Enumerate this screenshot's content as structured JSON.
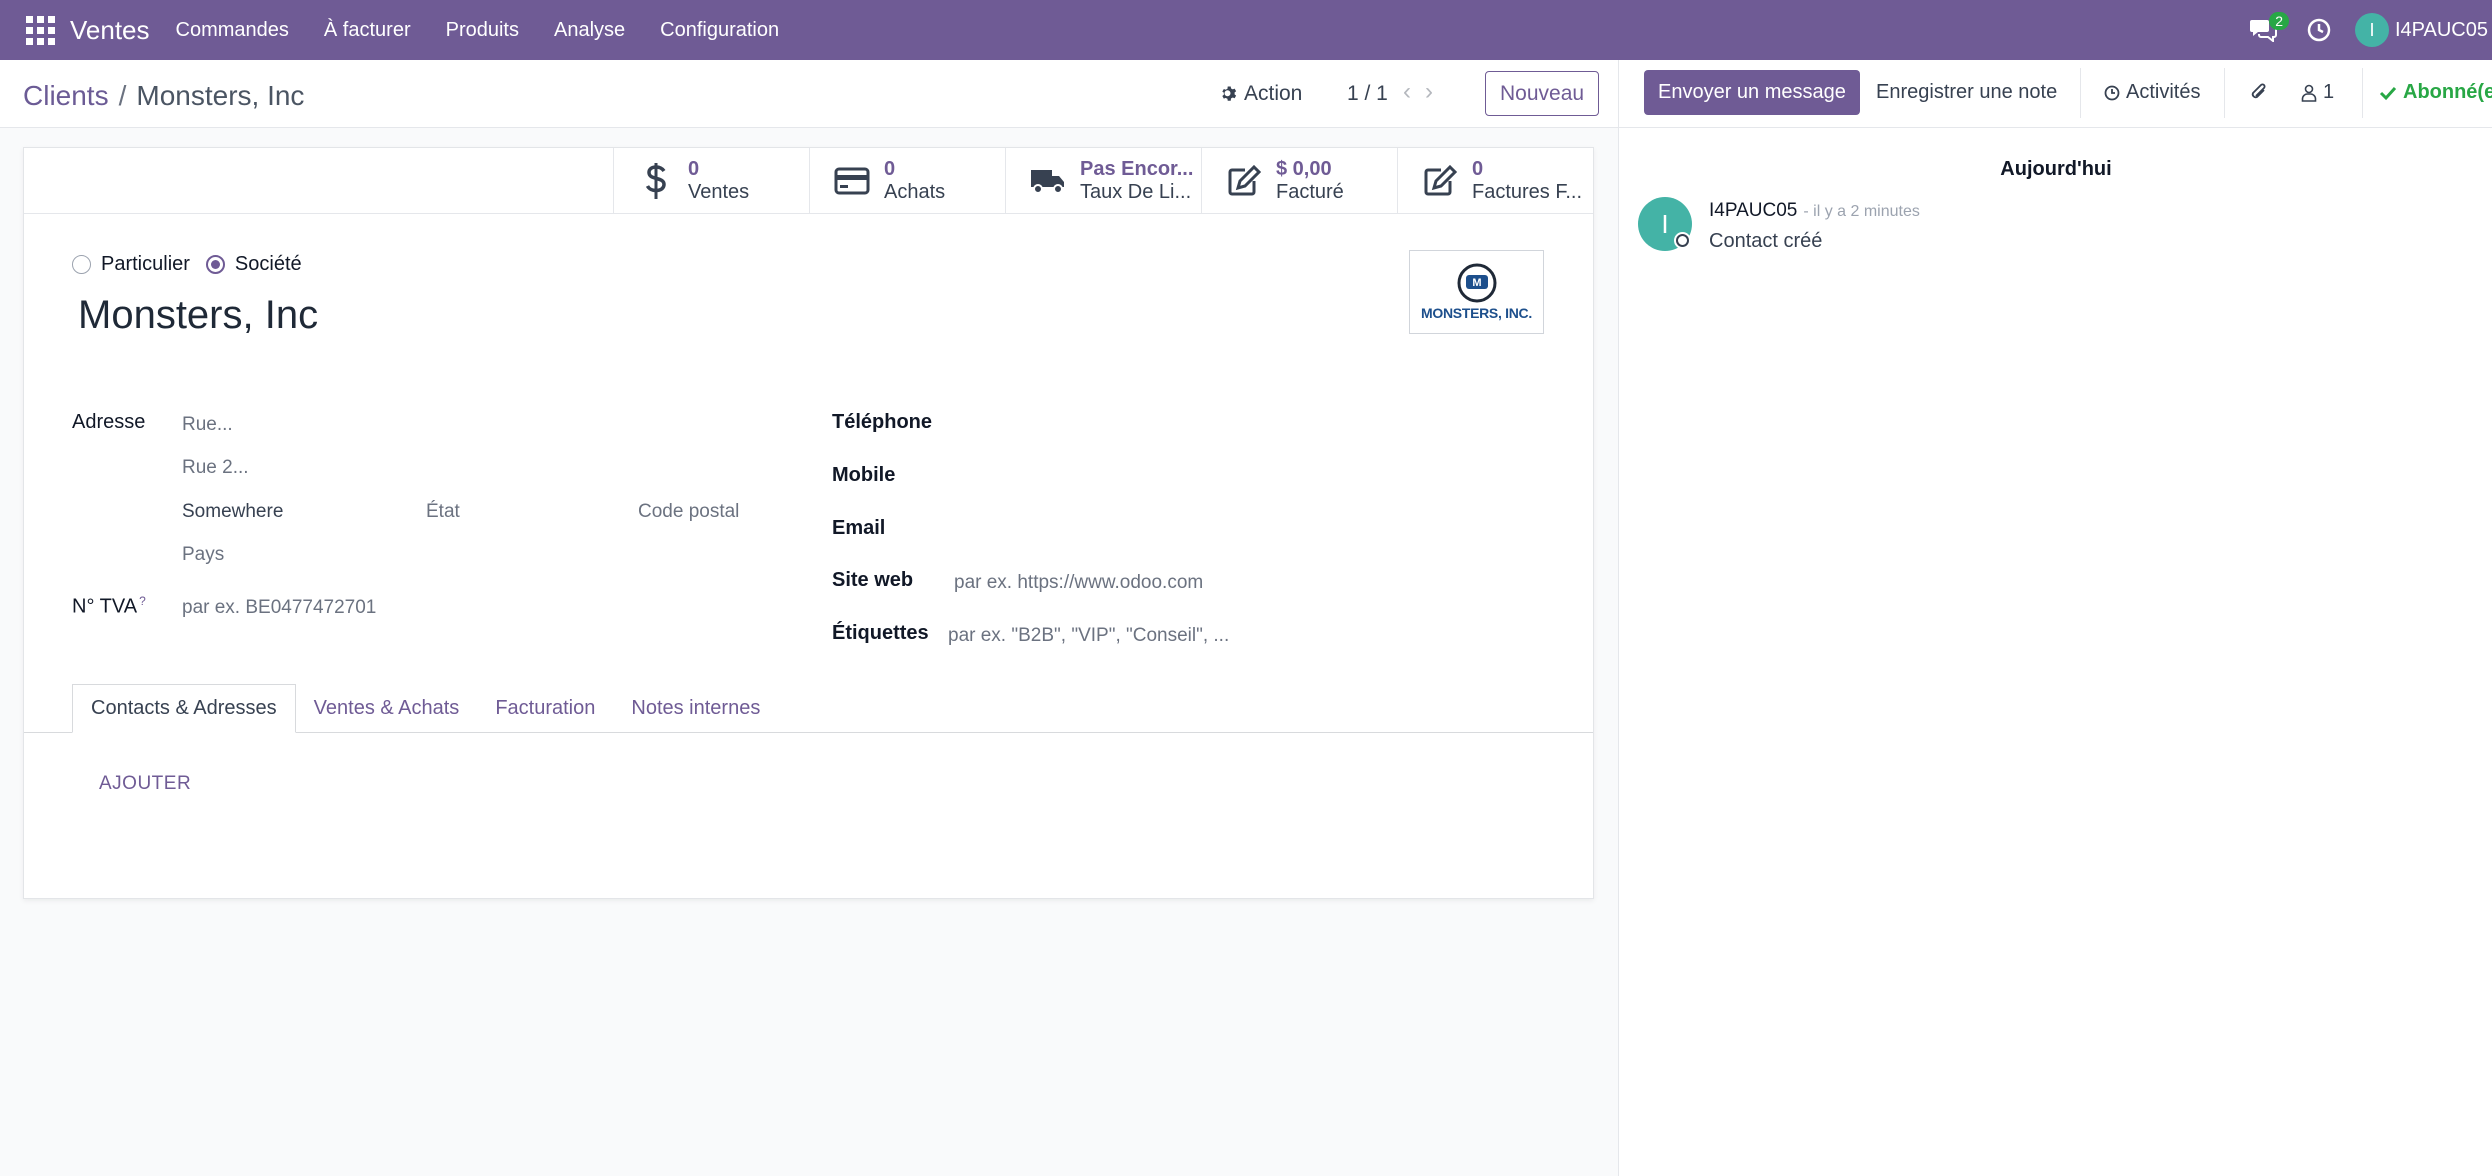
{
  "navbar": {
    "brand": "Ventes",
    "menu": [
      "Commandes",
      "À facturer",
      "Produits",
      "Analyse",
      "Configuration"
    ],
    "messages_badge": "2",
    "user_initial": "I",
    "user_name": "I4PAUC05",
    "accent_color": "#6f5b95"
  },
  "control_panel": {
    "breadcrumb_parent": "Clients",
    "breadcrumb_sep": "/",
    "breadcrumb_current": "Monsters, Inc",
    "action_label": "Action",
    "pager": "1 / 1",
    "new_label": "Nouveau"
  },
  "stat_buttons": [
    {
      "icon": "dollar-icon",
      "value": "0",
      "label": "Ventes"
    },
    {
      "icon": "credit-card-icon",
      "value": "0",
      "label": "Achats"
    },
    {
      "icon": "truck-icon",
      "value": "Pas Encor...",
      "label": "Taux De Li..."
    },
    {
      "icon": "pencil-square-icon",
      "value": "$ 0,00",
      "label": "Facturé"
    },
    {
      "icon": "pencil-square-icon",
      "value": "0",
      "label": "Factures F..."
    }
  ],
  "form": {
    "type_individual": "Particulier",
    "type_company": "Société",
    "company_name": "Monsters, Inc",
    "logo_text": "MONSTERS, INC.",
    "address_label": "Adresse",
    "street_ph": "Rue...",
    "street2_ph": "Rue 2...",
    "city": "Somewhere",
    "state_ph": "État",
    "zip_ph": "Code postal",
    "country_ph": "Pays",
    "vat_label": "N° TVA",
    "vat_help": "?",
    "vat_ph": "par ex. BE0477472701",
    "phone_label": "Téléphone",
    "mobile_label": "Mobile",
    "email_label": "Email",
    "website_label": "Site web",
    "website_ph": "par ex. https://www.odoo.com",
    "tags_label": "Étiquettes",
    "tags_ph": "par ex. \"B2B\", \"VIP\", \"Conseil\", ..."
  },
  "tabs": [
    "Contacts & Adresses",
    "Ventes & Achats",
    "Facturation",
    "Notes internes"
  ],
  "add_label": "AJOUTER",
  "chatter": {
    "send_message": "Envoyer un message",
    "log_note": "Enregistrer une note",
    "activities": "Activités",
    "followers_count": "1",
    "follow_label": "Abonné(e)",
    "today": "Aujourd'hui",
    "message": {
      "author_initial": "I",
      "author": "I4PAUC05",
      "time": "- il y a 2 minutes",
      "body": "Contact créé"
    }
  }
}
